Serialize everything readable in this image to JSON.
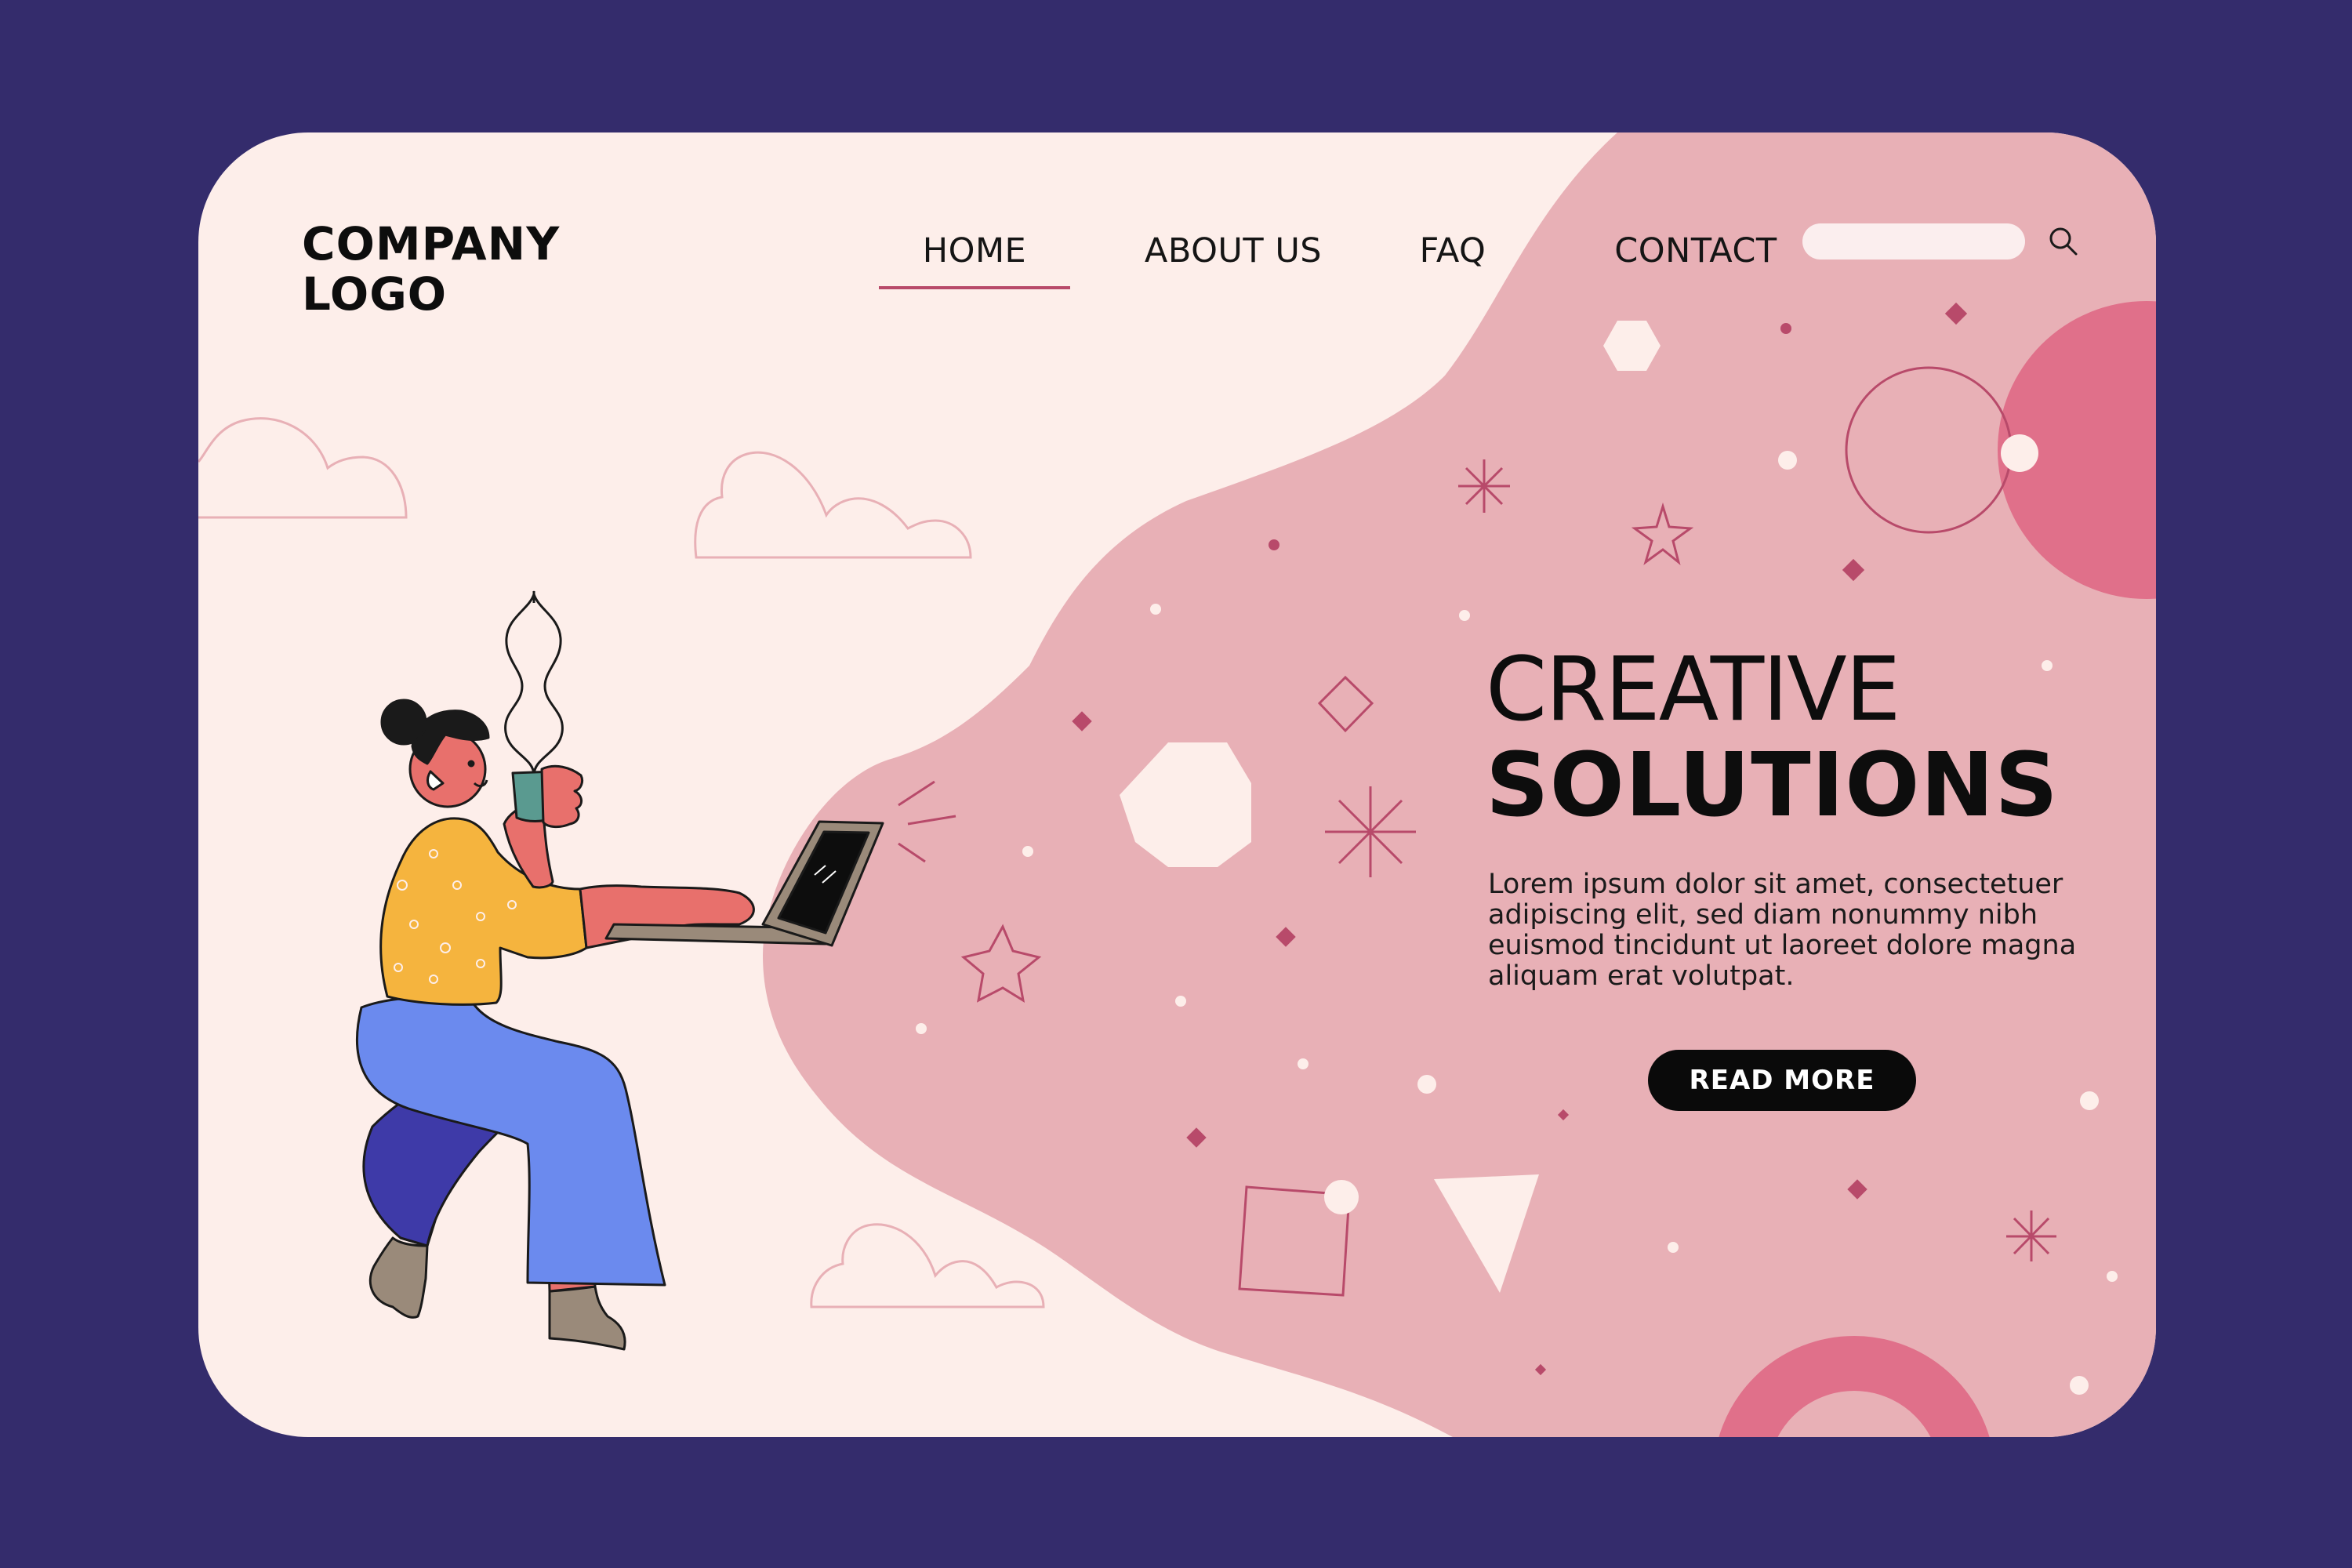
{
  "brand": {
    "logo_line1": "COMPANY",
    "logo_line2": "LOGO"
  },
  "nav": {
    "active": "HOME",
    "items": [
      {
        "label": "HOME"
      },
      {
        "label": "ABOUT US"
      },
      {
        "label": "FAQ"
      },
      {
        "label": "CONTACT"
      }
    ]
  },
  "search": {
    "value": "",
    "icon": "search-icon"
  },
  "hero": {
    "title_line1": "CREATIVE",
    "title_line2": "SOLUTIONS",
    "body": "Lorem ipsum dolor sit amet, consectetuer adipiscing elit, sed diam nonummy nibh euismod tincidunt ut laoreet dolore magna aliquam erat volutpat.",
    "cta_label": "READ MORE",
    "illustration": "woman-with-laptop-and-coffee"
  },
  "colors": {
    "page_background": "#342c6c",
    "card_background": "#fdeeea",
    "blob": "#e8b0b6",
    "accent_pink": "#e0708a",
    "accent_line": "#b84a6a",
    "button": "#0a0a0a",
    "text": "#0d0d0d"
  }
}
